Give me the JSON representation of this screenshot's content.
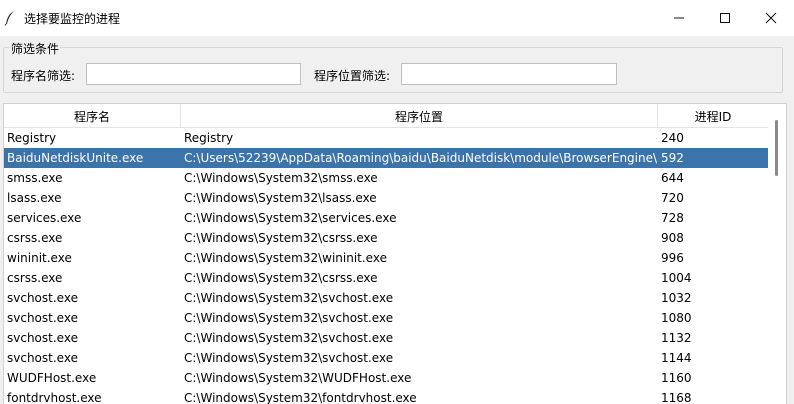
{
  "window": {
    "title": "选择要监控的进程",
    "icon": "feather-icon",
    "controls": [
      "minimize-icon",
      "maximize-icon",
      "close-icon"
    ]
  },
  "filter": {
    "legend": "筛选条件",
    "name_label": "程序名筛选:",
    "name_value": "",
    "path_label": "程序位置筛选:",
    "path_value": ""
  },
  "table": {
    "columns": [
      "程序名",
      "程序位置",
      "进程ID"
    ],
    "selected_index": 1,
    "rows": [
      {
        "name": "Registry",
        "path": "Registry",
        "pid": "240"
      },
      {
        "name": "BaiduNetdiskUnite.exe",
        "path": "C:\\Users\\52239\\AppData\\Roaming\\baidu\\BaiduNetdisk\\module\\BrowserEngine\\",
        "pid": "592"
      },
      {
        "name": "smss.exe",
        "path": "C:\\Windows\\System32\\smss.exe",
        "pid": "644"
      },
      {
        "name": "lsass.exe",
        "path": "C:\\Windows\\System32\\lsass.exe",
        "pid": "720"
      },
      {
        "name": "services.exe",
        "path": "C:\\Windows\\System32\\services.exe",
        "pid": "728"
      },
      {
        "name": "csrss.exe",
        "path": "C:\\Windows\\System32\\csrss.exe",
        "pid": "908"
      },
      {
        "name": "wininit.exe",
        "path": "C:\\Windows\\System32\\wininit.exe",
        "pid": "996"
      },
      {
        "name": "csrss.exe",
        "path": "C:\\Windows\\System32\\csrss.exe",
        "pid": "1004"
      },
      {
        "name": "svchost.exe",
        "path": "C:\\Windows\\System32\\svchost.exe",
        "pid": "1032"
      },
      {
        "name": "svchost.exe",
        "path": "C:\\Windows\\System32\\svchost.exe",
        "pid": "1080"
      },
      {
        "name": "svchost.exe",
        "path": "C:\\Windows\\System32\\svchost.exe",
        "pid": "1132"
      },
      {
        "name": "svchost.exe",
        "path": "C:\\Windows\\System32\\svchost.exe",
        "pid": "1144"
      },
      {
        "name": "WUDFHost.exe",
        "path": "C:\\Windows\\System32\\WUDFHost.exe",
        "pid": "1160"
      },
      {
        "name": "fontdrvhost.exe",
        "path": "C:\\Windows\\System32\\fontdrvhost.exe",
        "pid": "1168"
      }
    ]
  },
  "colors": {
    "selection": "#3b73ab",
    "window_bg": "#f0f0f0"
  }
}
